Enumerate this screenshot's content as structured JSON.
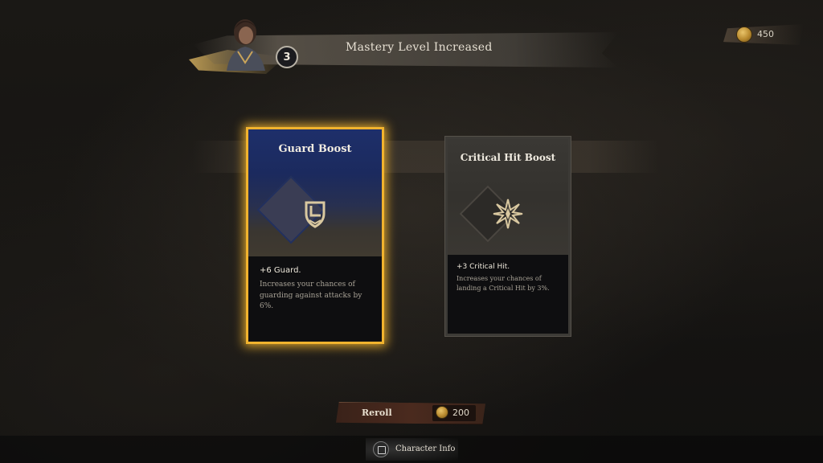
{
  "header": {
    "level": "3",
    "title": "Mastery Level Increased"
  },
  "currency": {
    "icon": "coin-icon",
    "amount": "450"
  },
  "cards": [
    {
      "title": "Guard Boost",
      "icon": "guard-shield-icon",
      "stat": "+6 Guard.",
      "description": "Increases your chances of guarding against attacks by 6%.",
      "selected": true,
      "accent": "#f1b32e",
      "theme_color": "#1e2f6a"
    },
    {
      "title": "Critical Hit Boost",
      "icon": "critical-star-icon",
      "stat": "+3 Critical Hit.",
      "description": "Increases your chances of landing a Critical Hit by 3%.",
      "selected": false
    }
  ],
  "reroll": {
    "label": "Reroll",
    "cost": "200",
    "icon": "coin-icon"
  },
  "footer": {
    "button_icon": "square-button-icon",
    "label": "Character Info"
  }
}
